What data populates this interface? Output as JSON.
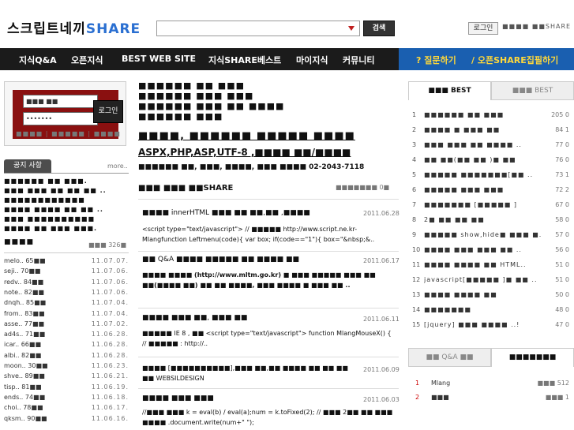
{
  "header": {
    "logo_kr": "스크립트네끼",
    "logo_share": "SHARE",
    "search_button": "검색",
    "login_link": "로그인",
    "join_link": "■■■■  ■■SHARE"
  },
  "nav": {
    "items": [
      "지식Q&A",
      "오픈지식",
      "BEST WEB SITE",
      "지식SHARE베스트",
      "마이지식",
      "커뮤니티"
    ],
    "question": "? 질문하기",
    "open_share": "/ 오픈SHARE집필하기"
  },
  "login": {
    "id_value": "■■■ ■■",
    "password_value": "•••••••",
    "button": "로그인",
    "links": "■■■■ | ■■■■■ | ■■■■"
  },
  "notice": {
    "tab": "공지 사항",
    "more": "more..",
    "lines": [
      "■■■■■■ ■■ ■■■.",
      "■■■ ■■■ ■■ ■■ ■■ ..",
      "■■■■■■■■■■■■",
      "■■■■ ■■■■ ■■ ■■ ..",
      "■■■ ■■■■■■■■■■",
      "■■■■ ■■ ■■■ ■■■."
    ],
    "section_title": "■■■■",
    "section_count": "■■■ 326■"
  },
  "left_list": [
    {
      "name": "melo.. 65■■",
      "date": "11.07.07."
    },
    {
      "name": "seji.. 70■■",
      "date": "11.07.06."
    },
    {
      "name": "redv.. 84■■",
      "date": "11.07.06."
    },
    {
      "name": "note.. 82■■",
      "date": "11.07.06."
    },
    {
      "name": "dnqh.. 85■■",
      "date": "11.07.04."
    },
    {
      "name": "from.. 83■■",
      "date": "11.07.04."
    },
    {
      "name": "asse.. 77■■",
      "date": "11.07.02."
    },
    {
      "name": "ad4s.. 71■■",
      "date": "11.06.28."
    },
    {
      "name": "icar.. 66■■",
      "date": "11.06.28."
    },
    {
      "name": "albi.. 82■■",
      "date": "11.06.28."
    },
    {
      "name": "moon.. 30■■",
      "date": "11.06.23."
    },
    {
      "name": "shve.. 89■■",
      "date": "11.06.21."
    },
    {
      "name": "tisp.. 81■■",
      "date": "11.06.19."
    },
    {
      "name": "ends.. 74■■",
      "date": "11.06.18."
    },
    {
      "name": "choi.. 78■■",
      "date": "11.06.17."
    },
    {
      "name": "qksm.. 90■■",
      "date": "11.06.16."
    }
  ],
  "center": {
    "intro_lines": [
      "■■■■■■ ■■ ■■■",
      "■■■■■■ ■■■ ■■■",
      "■■■■■■ ■■■ ■■ ■■■■",
      "■■■■■■ ■■■"
    ],
    "headline": "■■■■, ■■■■■■ ■■■■■ ■■■■",
    "subline": "ASPX,PHP,ASP,UTF-8 ,■■■■ ■■/■■■■",
    "contact": "■■■■■■ ■■, ■■■, ■■■■, ■■■ ■■■■ 02-2043-7118",
    "section_title": "■■■ ■■■ ■■SHARE",
    "section_more": "■■■■■■■ 0■",
    "posts": [
      {
        "title": "■■■■  innerHTML ■■■ ■■ ■■,■■ ,■■■■",
        "date": "2011.06.28",
        "body": "<script type=\"text/javascript\"> // ■■■■■ http://www.script.ne.kr- Mlangfunction Leftmenu(code){ var box; if(code==\"1\"){ box=\"&nbsp;&.."
      },
      {
        "title": "■■ Q&A ■■■■ ■■■■■ ■■ ■■■■ ■■",
        "date": "2011.06.17",
        "body": "■■■■ ■■■■ (http://www.mltm.go.kr) ■ ■■■ ■■■■■ ■■■ ■■ ■■(■■■■ ■■) ■■ ■■ ■■■■, ■■■ ■■■■ ■ ■■■ ■■ .."
      },
      {
        "title": "■■■■  ■■■ ■■, ■■■ ■■",
        "date": "2011.06.11",
        "body": "■■■■■ IE 8 , ■■   <script type=\"text/javascript\">    function MlangMouseX() {     // ■■■■■ : http://.."
      },
      {
        "title": "■■■■  [■■■■■■■■■■],■■■ ■■,■■ ■■■■ ■■ ■■ ■■ ■■ WEBSILDESIGN",
        "date": "2011.06.09",
        "body": ""
      },
      {
        "title": "■■■■  ■■■ ■■■",
        "date": "2011.06.03",
        "body": "//■■■ ■■■ k = eval(b) / eval(a);num = k.toFixed(2); // ■■■ 2■■ ■■ ■■■ ■■■■ .document.write(num+\" \");"
      }
    ]
  },
  "right": {
    "best_tab": "■■■ BEST",
    "best_tab2": "■■■ BEST",
    "rows": [
      {
        "rank": "1",
        "title": "■■■■■■ ■■ ■■■",
        "v": "205  0"
      },
      {
        "rank": "2",
        "title": "■■■■ ■ ■■■ ■■",
        "v": "84  1"
      },
      {
        "rank": "3",
        "title": "■■■ ■■■ ■■ ■■■■ ..",
        "v": "77  0"
      },
      {
        "rank": "4",
        "title": "■■ ■■(■■ ■■ )■ ■■",
        "v": "76  0"
      },
      {
        "rank": "5",
        "title": "■■■■■ ■■■■■■■[■■ ..",
        "v": "73  1"
      },
      {
        "rank": "6",
        "title": "■■■■■ ■■■ ■■■",
        "v": "72  2"
      },
      {
        "rank": "7",
        "title": "■■■■■■■ [■■■■■ ]",
        "v": "67  0"
      },
      {
        "rank": "8",
        "title": "2■ ■■ ■■ ■■",
        "v": "58  0"
      },
      {
        "rank": "9",
        "title": "■■■■■ show,hide■ ■■■ ■..",
        "v": "57  0"
      },
      {
        "rank": "10",
        "title": "■■■■ ■■■ ■■■ ■■ ..",
        "v": "56  0"
      },
      {
        "rank": "11",
        "title": "■■■■ ■■■■ ■■ HTML..",
        "v": "51  0"
      },
      {
        "rank": "12",
        "title": "javascript[■■■■■ ]■ ■■ ..",
        "v": "51  0"
      },
      {
        "rank": "13",
        "title": "■■■■ ■■■■ ■■",
        "v": "50  0"
      },
      {
        "rank": "14",
        "title": "■■■■■■■",
        "v": "48  0"
      },
      {
        "rank": "15",
        "title": "[jquery] ■■■ ■■■■ ..!",
        "v": "47  0"
      }
    ],
    "qa_tab": "■■ Q&A ■■",
    "qa_tab2": "■■■■■■■",
    "qa_rows": [
      {
        "rank": "1",
        "title": "Mlang",
        "v": "■■■ 512"
      },
      {
        "rank": "2",
        "title": "■■■",
        "v": "■■■ 1"
      }
    ]
  }
}
